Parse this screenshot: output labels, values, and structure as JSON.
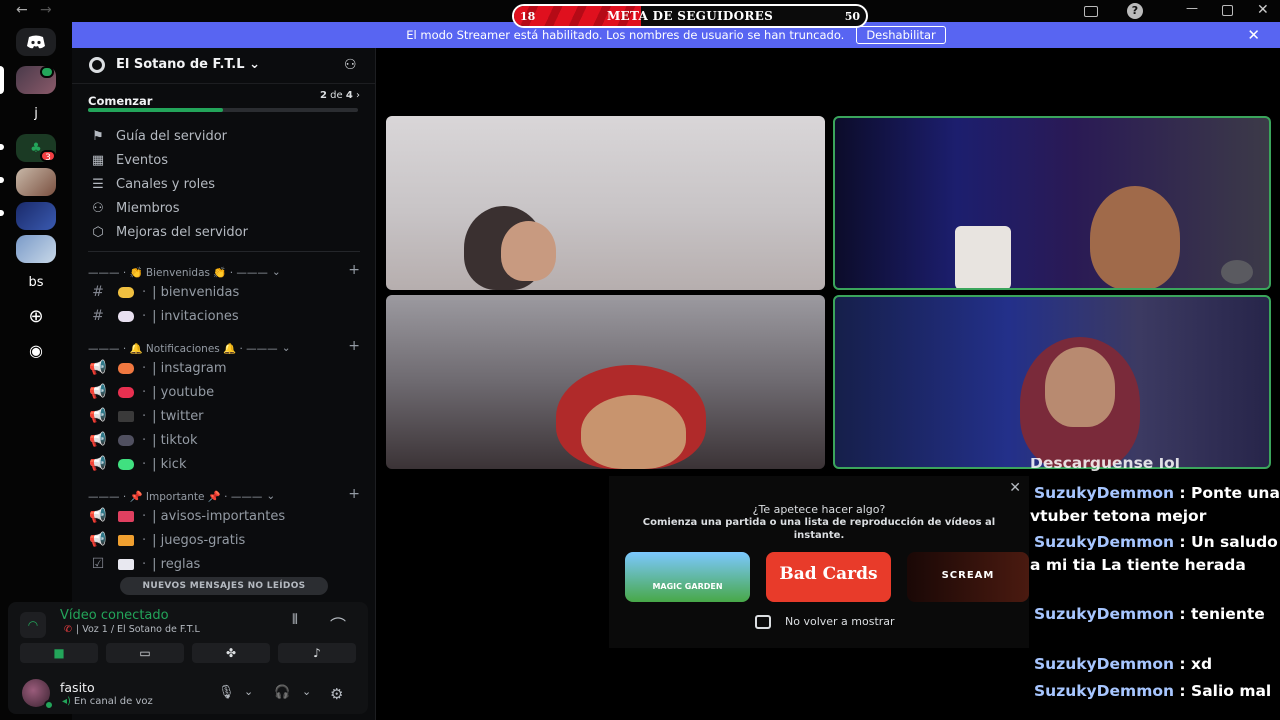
{
  "window": {
    "title": "Sotano de F.T.L",
    "back_icon": "arrow-left-icon",
    "forward_icon": "arrow-right-icon"
  },
  "goal": {
    "title": "META DE SEGUIDORES",
    "current": "18",
    "target": "50",
    "progress": 0.36
  },
  "banner": {
    "text": "El modo Streamer está habilitado. Los nombres de usuario se han truncado.",
    "button": "Deshabilitar"
  },
  "rail": {
    "items": [
      "j",
      "bs"
    ],
    "badge": "3"
  },
  "server": {
    "name": "El Sotano de F.T.L",
    "chevron": "⌄"
  },
  "onboarding": {
    "title": "Comenzar",
    "count_current": "2",
    "count_sep": "de",
    "count_total": "4",
    "progress": 0.5
  },
  "menu": [
    {
      "label": "Guía del servidor",
      "icon": "signpost-icon"
    },
    {
      "label": "Eventos",
      "icon": "calendar-icon"
    },
    {
      "label": "Canales y roles",
      "icon": "list-icon"
    },
    {
      "label": "Miembros",
      "icon": "members-icon"
    },
    {
      "label": "Mejoras del servidor",
      "icon": "boost-icon"
    }
  ],
  "categories": [
    {
      "label": "——— · 👏 Bienvenidas 👏 · ———",
      "channels": [
        {
          "name": "| bienvenidas",
          "type": "text",
          "emoji_color": "#f0c040"
        },
        {
          "name": "| invitaciones",
          "type": "text",
          "emoji_color": "#e8e0f0"
        }
      ]
    },
    {
      "label": "——— · 🔔 Notificaciones 🔔 · ———",
      "channels": [
        {
          "name": "| instagram",
          "type": "announce",
          "emoji_color": "#f07840"
        },
        {
          "name": "| youtube",
          "type": "announce",
          "emoji_color": "#e83050"
        },
        {
          "name": "| twitter",
          "type": "announce",
          "emoji_color": "#3a3a3a"
        },
        {
          "name": "| tiktok",
          "type": "announce",
          "emoji_color": "#505060"
        },
        {
          "name": "| kick",
          "type": "announce",
          "emoji_color": "#40e080"
        }
      ]
    },
    {
      "label": "——— · 📌 Importante 📌 · ———",
      "channels": [
        {
          "name": "| avisos-importantes",
          "type": "announce",
          "emoji_color": "#e04060"
        },
        {
          "name": "| juegos-gratis",
          "type": "announce",
          "emoji_color": "#f0a030"
        },
        {
          "name": "| reglas",
          "type": "rules",
          "emoji_color": "#e8e8f0"
        }
      ]
    }
  ],
  "unread_pill": "NUEVOS MENSAJES NO LEÍDOS",
  "voice": {
    "status": "Vídeo conectado",
    "channel": "| Voz 1 / El Sotano de F.T.L",
    "buttons": [
      "camera-icon",
      "screen-share-icon",
      "activity-icon",
      "soundboard-icon"
    ]
  },
  "user": {
    "name": "fasito",
    "status": "En canal de voz"
  },
  "activity": {
    "title": "¿Te apetece hacer algo?",
    "subtitle": "Comienza una partida o una lista de reproducción de vídeos al instante.",
    "games": [
      {
        "name": "MAGIC GARDEN",
        "color": "#5fb8e8"
      },
      {
        "name": "Bad Cards",
        "color": "#e83b2a"
      },
      {
        "name": "SCREAM",
        "color": "#2a0d0a"
      }
    ],
    "dont_show": "No volver a mostrar"
  },
  "chat": {
    "clipped_line": "Descarguense lol",
    "messages": [
      {
        "user": "SuzukyDemmon",
        "text": "Ponte una vtuber tetona mejor"
      },
      {
        "user": "SuzukyDemmon",
        "text": "Un saludo a mi tia La tiente herada"
      },
      {
        "user": "SuzukyDemmon",
        "text": "teniente"
      },
      {
        "user": "SuzukyDemmon",
        "text": "xd"
      },
      {
        "user": "SuzukyDemmon",
        "text": "Salio mal"
      }
    ]
  },
  "colors": {
    "accent": "#5865f2",
    "online": "#23a55a",
    "speaking": "#3ba55c",
    "goal_fill": "#e0101e"
  }
}
